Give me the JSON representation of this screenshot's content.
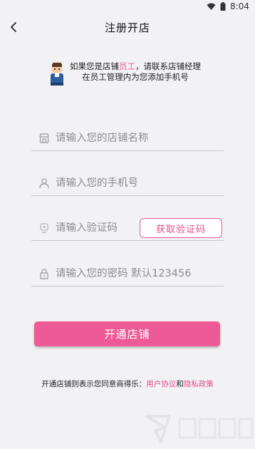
{
  "status": {
    "time": "8:04"
  },
  "header": {
    "title": "注册开店"
  },
  "notice": {
    "line1_prefix": "如果您是店铺",
    "line1_highlight": "员工",
    "line1_suffix": "，请联系店铺经理",
    "line2": "在员工管理内为您添加手机号"
  },
  "form": {
    "store_name_placeholder": "请输入您的店铺名称",
    "phone_placeholder": "请输入您的手机号",
    "code_placeholder": "请输入验证码",
    "get_code_label": "获取验证码",
    "password_placeholder": "请输入您的密码 默认123456",
    "submit_label": "开通店铺"
  },
  "agreement": {
    "prefix": "开通店铺则表示您同意商得乐：",
    "user_agreement": "用户协议",
    "and": "和",
    "privacy_policy": "隐私政策"
  },
  "colors": {
    "accent": "#ee5a95",
    "link": "#e2508a",
    "background": "#f2f1f4"
  }
}
